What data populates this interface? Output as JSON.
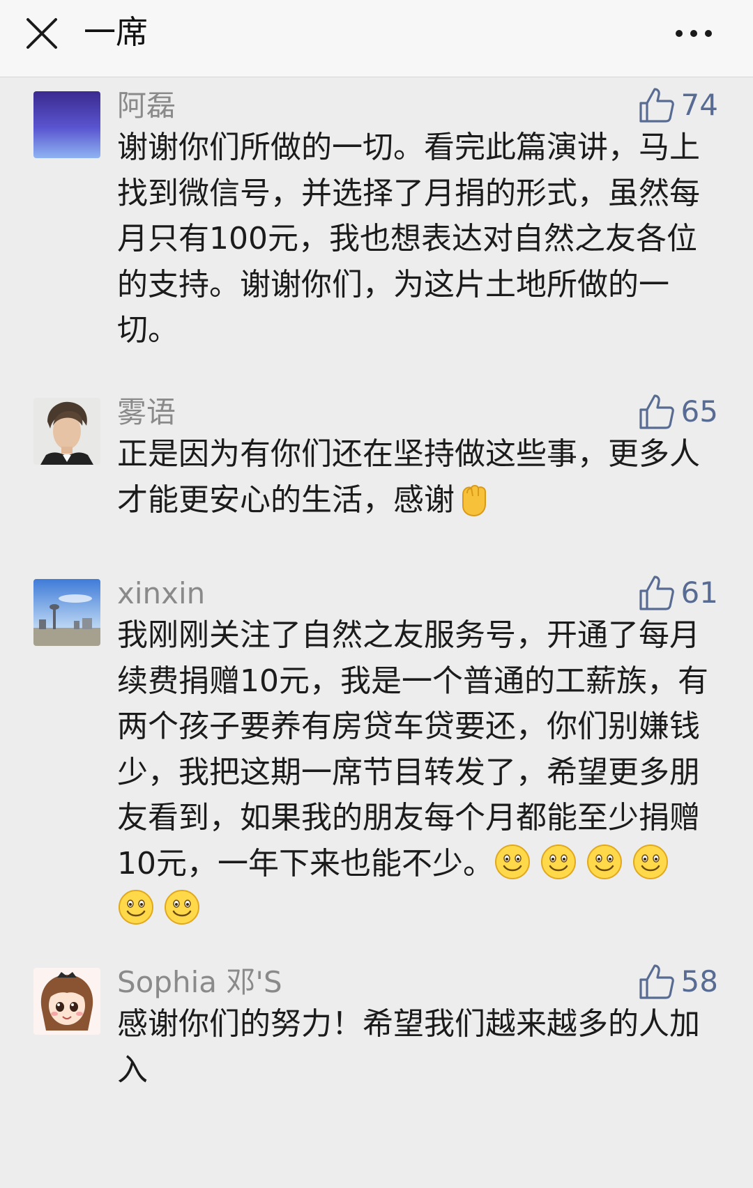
{
  "header": {
    "title": "一席",
    "close_icon": "close-icon",
    "more_icon": "more-dots-icon"
  },
  "comments": [
    {
      "username": "阿磊",
      "likes": "74",
      "text": "谢谢你们所做的一切。看完此篇演讲，马上找到微信号，并选择了月捐的形式，虽然每月只有100元，我也想表达对自然之友各位的支持。谢谢你们，为这片土地所做的一切。",
      "avatar_icon": "purple-gradient-avatar"
    },
    {
      "username": "雾语",
      "likes": "65",
      "text": "正是因为有你们还在坚持做这些事，更多人才能更安心的生活，感谢",
      "emoji": [
        "fist-emoji"
      ],
      "avatar_icon": "man-portrait-avatar"
    },
    {
      "username": "xinxin",
      "likes": "61",
      "text": "我刚刚关注了自然之友服务号，开通了每月续费捐赠10元，我是一个普通的工薪族，有两个孩子要养有房贷车贷要还，你们别嫌钱少，我把这期一席节目转发了，希望更多朋友看到，如果我的朋友每个月都能至少捐赠10元，一年下来也能不少。",
      "emoji": [
        "smile-emoji",
        "smile-emoji",
        "smile-emoji",
        "smile-emoji",
        "smile-emoji",
        "smile-emoji"
      ],
      "avatar_icon": "city-skyline-avatar"
    },
    {
      "username": "Sophia 邓'S",
      "likes": "58",
      "text": "感谢你们的努力！希望我们越来越多的人加入",
      "avatar_icon": "cartoon-girl-avatar"
    }
  ],
  "colors": {
    "background": "#ededed",
    "like_blue": "#586b93",
    "username_gray": "#8a8a8a"
  }
}
